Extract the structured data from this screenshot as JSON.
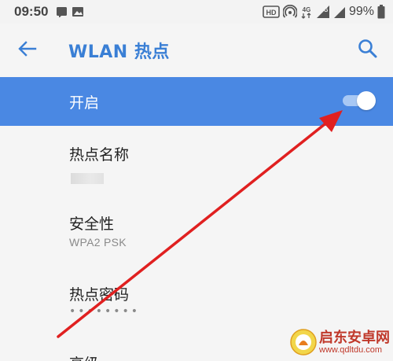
{
  "status_bar": {
    "time": "09:50",
    "battery": "99%",
    "network": "4G"
  },
  "app_bar": {
    "title": "WLAN 热点"
  },
  "toggle": {
    "label": "开启",
    "state": true
  },
  "items": [
    {
      "title": "热点名称",
      "summary": ""
    },
    {
      "title": "安全性",
      "summary": "WPA2 PSK"
    },
    {
      "title": "热点密码",
      "summary": "••••••••"
    },
    {
      "title": "高级",
      "summary": ""
    }
  ],
  "watermark": {
    "text": "启东安卓网",
    "url": "www.qdltdu.com"
  },
  "colors": {
    "accent": "#3a7fd5",
    "toggle_row_bg": "#4a88e3",
    "arrow": "#e02020"
  }
}
